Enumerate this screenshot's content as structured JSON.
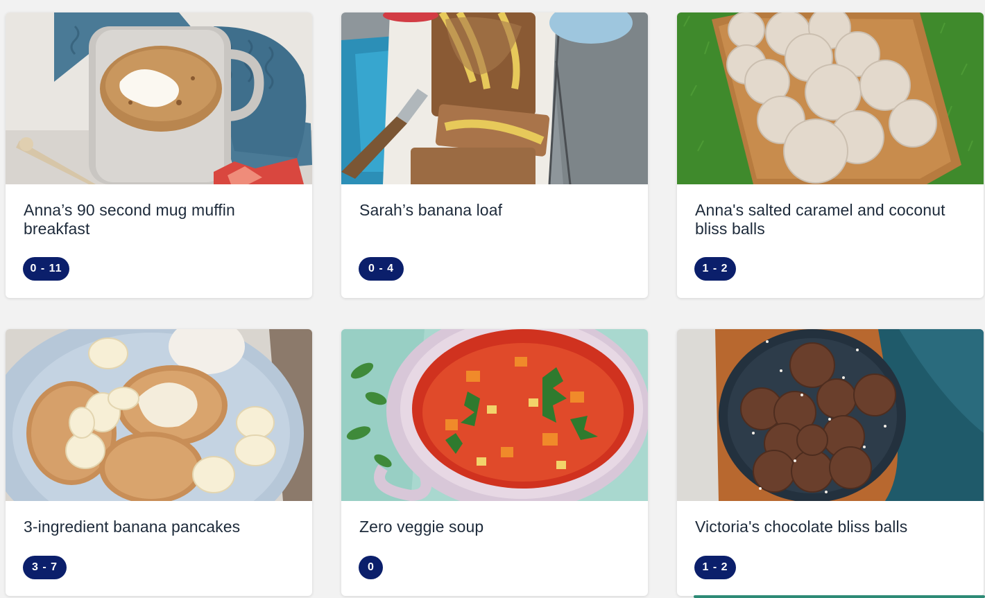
{
  "recipes": [
    {
      "title": "Anna’s 90 second mug muffin breakfast",
      "badge": "0 - 11"
    },
    {
      "title": "Sarah’s banana loaf",
      "badge": "0 - 4"
    },
    {
      "title": "Anna's salted caramel and coconut bliss balls",
      "badge": "1 - 2"
    },
    {
      "title": "3-ingredient banana pancakes",
      "badge": "3 - 7"
    },
    {
      "title": "Zero veggie soup",
      "badge": "0"
    },
    {
      "title": "Victoria's chocolate bliss balls",
      "badge": "1 - 2"
    }
  ],
  "colors": {
    "badge": "#0b1f6b",
    "title": "#1d2a3a",
    "background": "#f2f2f2"
  }
}
